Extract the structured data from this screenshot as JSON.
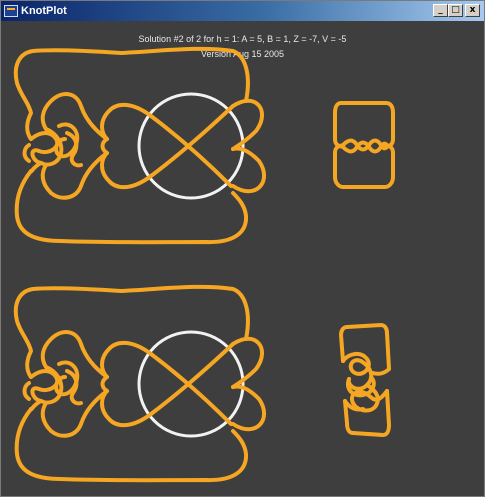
{
  "window": {
    "title": "KnotPlot",
    "buttons": {
      "minimize": "_",
      "maximize": "□",
      "close": "x"
    }
  },
  "canvas": {
    "solution_text": "Solution #2 of 2 for h = 1: A = 5, B = 1, Z = -7, V = -5",
    "version_text": "Version Aug 15 2005"
  },
  "colors": {
    "background": "#3e3e3e",
    "knot": "#f5a623",
    "circle": "#f2f2f2"
  }
}
